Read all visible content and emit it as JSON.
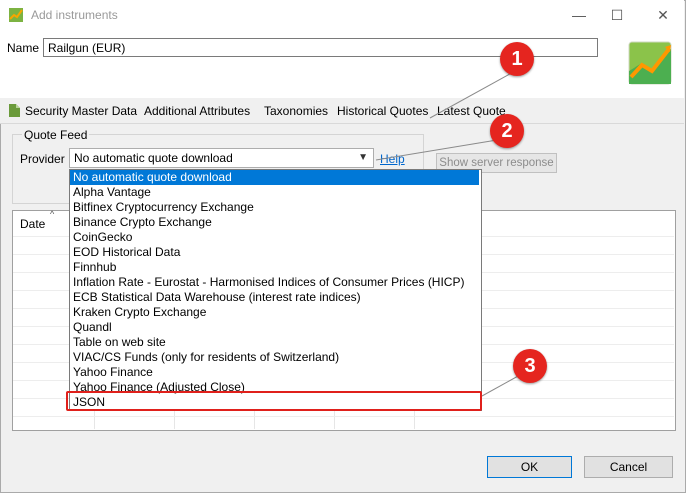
{
  "window": {
    "title": "Add instruments",
    "controls": {
      "minimize": "—",
      "maximize": "☐",
      "close": "✕"
    }
  },
  "name_field": {
    "label": "Name",
    "value": "Railgun (EUR)"
  },
  "tabs": [
    {
      "label": "Security Master Data"
    },
    {
      "label": "Additional Attributes"
    },
    {
      "label": "Taxonomies"
    },
    {
      "label": "Historical Quotes"
    },
    {
      "label": "Latest Quote"
    }
  ],
  "quote_feed": {
    "legend": "Quote Feed",
    "provider_label": "Provider",
    "provider_value": "No automatic quote download",
    "help_link": "Help",
    "server_button": "Show server response"
  },
  "table": {
    "date_header": "Date"
  },
  "dropdown": {
    "options": [
      "No automatic quote download",
      "Alpha Vantage",
      "Bitfinex Cryptocurrency Exchange",
      "Binance Crypto Exchange",
      "CoinGecko",
      "EOD Historical Data",
      "Finnhub",
      "Inflation Rate - Eurostat - Harmonised Indices of Consumer Prices (HICP)",
      "ECB Statistical Data Warehouse (interest rate indices)",
      "Kraken Crypto Exchange",
      "Quandl",
      "Table on web site",
      "VIAC/CS Funds (only for residents of Switzerland)",
      "Yahoo Finance",
      "Yahoo Finance (Adjusted Close)",
      "JSON"
    ],
    "selected_index": 0
  },
  "callouts": [
    "1",
    "2",
    "3"
  ],
  "footer": {
    "ok": "OK",
    "cancel": "Cancel"
  },
  "colors": {
    "selection": "#0078d7",
    "callout": "#e5251f",
    "link": "#0066cc"
  }
}
